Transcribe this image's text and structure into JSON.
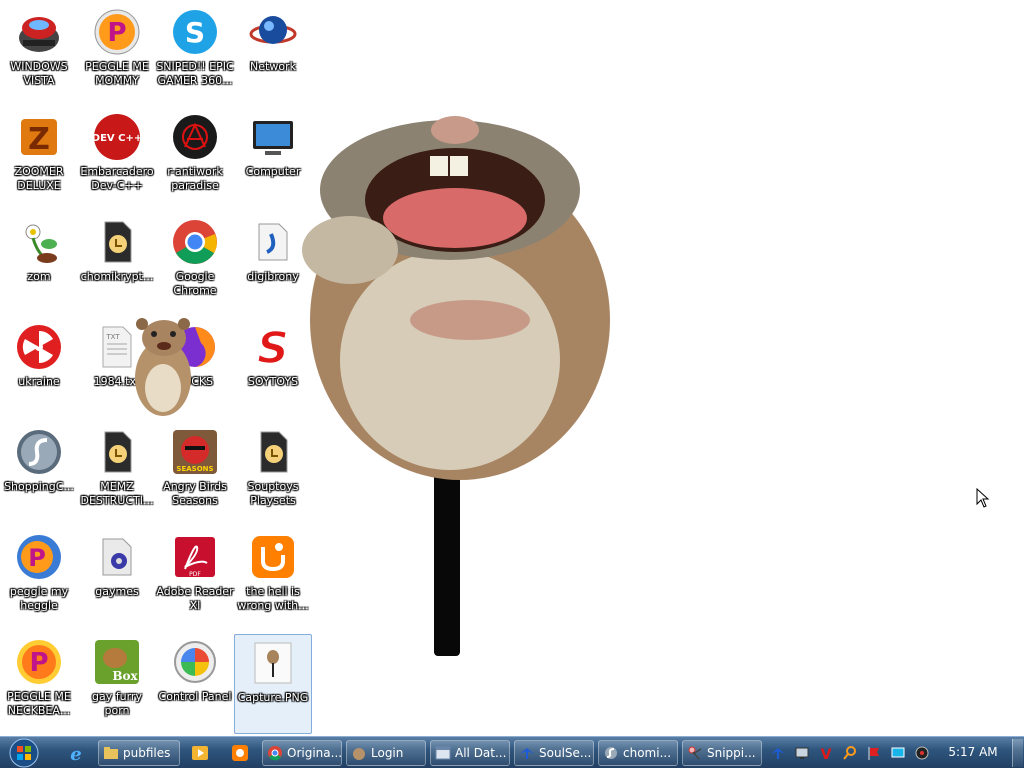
{
  "desktop": {
    "icons": [
      {
        "label": "WINDOWS VISTA"
      },
      {
        "label": "PEGGLE ME MOMMY"
      },
      {
        "label": "SNIPED!! EPIC GAMER 360..."
      },
      {
        "label": "Network"
      },
      {
        "label": "ZOOMER DELUXE"
      },
      {
        "label": "Embarcadero Dev-C++"
      },
      {
        "label": "r-antiwork paradise"
      },
      {
        "label": "Computer"
      },
      {
        "label": "zom"
      },
      {
        "label": "chomikrypt..."
      },
      {
        "label": "Google Chrome"
      },
      {
        "label": "digibrony"
      },
      {
        "label": "ukraine"
      },
      {
        "label": "1984.txt"
      },
      {
        "label": "FUCKS"
      },
      {
        "label": "SOYTOYS"
      },
      {
        "label": "ShoppingC..."
      },
      {
        "label": "MEMZ DESTRUCTI..."
      },
      {
        "label": "Angry Birds Seasons"
      },
      {
        "label": "Souptoys Playsets"
      },
      {
        "label": "peggle my heggle"
      },
      {
        "label": "gaymes"
      },
      {
        "label": "Adobe Reader XI"
      },
      {
        "label": "the hell is wrong with..."
      },
      {
        "label": "PEGGLE ME NECKBEA..."
      },
      {
        "label": "gay furry porn"
      },
      {
        "label": "Control Panel"
      },
      {
        "label": "Capture.PNG"
      }
    ],
    "icon_badges": {
      "devcpp": "DEV C++",
      "box": "Box",
      "angry_birds": "SEASONS",
      "pdf": "PDF",
      "txt": "TXT"
    }
  },
  "taskbar": {
    "buttons": [
      {
        "label": "pubfiles",
        "icon": "folder-icon"
      },
      {
        "label": "Origina...",
        "icon": "chrome-icon"
      },
      {
        "label": "Login",
        "icon": "hamster-icon"
      },
      {
        "label": "All Dat...",
        "icon": "window-icon"
      },
      {
        "label": "SoulSe...",
        "icon": "bird-icon"
      },
      {
        "label": "chomi...",
        "icon": "app-icon"
      },
      {
        "label": "Snippi...",
        "icon": "scissors-icon"
      }
    ],
    "clock": "5:17 AM"
  },
  "colors": {
    "taskbar": "#2f567e",
    "label_text": "#ffffff"
  }
}
